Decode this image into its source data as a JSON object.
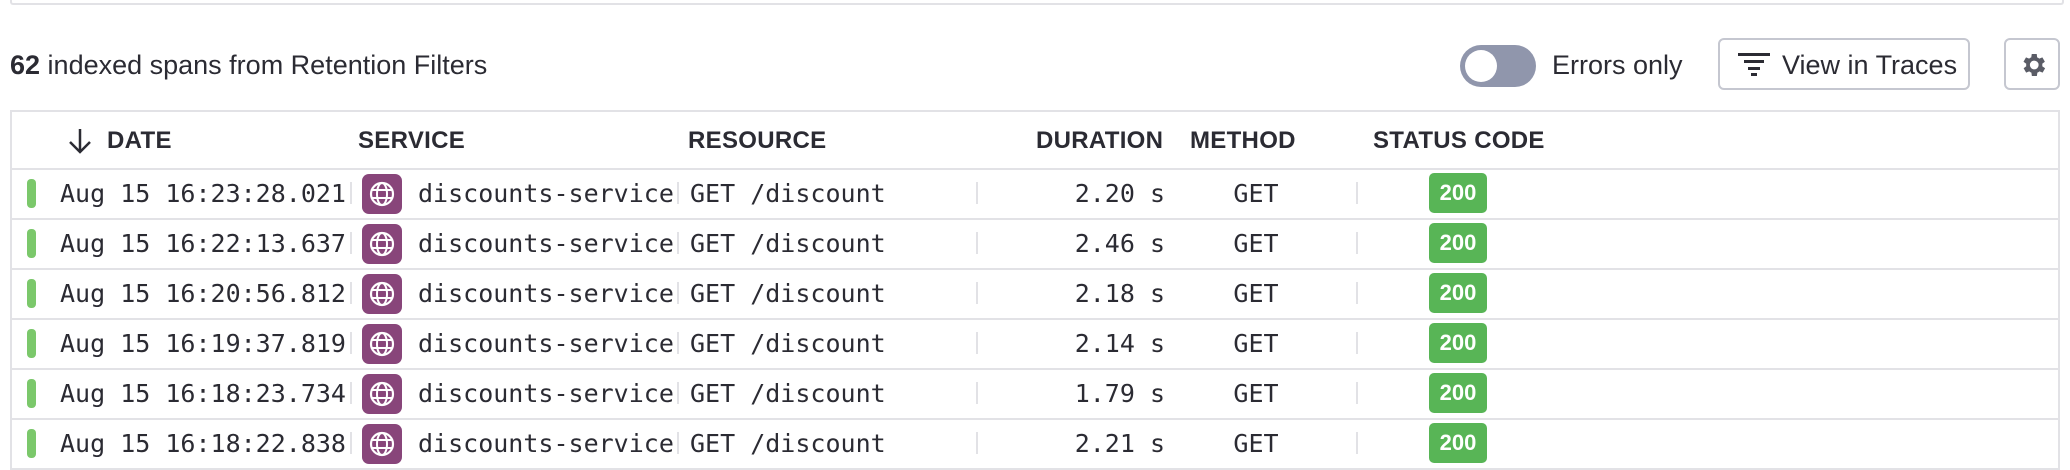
{
  "summary": {
    "count": "62",
    "text": " indexed spans from Retention Filters"
  },
  "toggle": {
    "label": "Errors only",
    "on": false
  },
  "toolbar": {
    "view_traces_label": "View in Traces"
  },
  "table": {
    "columns": {
      "date": "DATE",
      "service": "SERVICE",
      "resource": "RESOURCE",
      "duration": "DURATION",
      "method": "METHOD",
      "status_code": "STATUS CODE"
    },
    "sort": {
      "column": "date",
      "direction": "descending"
    },
    "rows": [
      {
        "date": "Aug 15 16:23:28.021",
        "service": "discounts-service",
        "resource": "GET /discount",
        "duration": "2.20 s",
        "method": "GET",
        "status_code": "200"
      },
      {
        "date": "Aug 15 16:22:13.637",
        "service": "discounts-service",
        "resource": "GET /discount",
        "duration": "2.46 s",
        "method": "GET",
        "status_code": "200"
      },
      {
        "date": "Aug 15 16:20:56.812",
        "service": "discounts-service",
        "resource": "GET /discount",
        "duration": "2.18 s",
        "method": "GET",
        "status_code": "200"
      },
      {
        "date": "Aug 15 16:19:37.819",
        "service": "discounts-service",
        "resource": "GET /discount",
        "duration": "2.14 s",
        "method": "GET",
        "status_code": "200"
      },
      {
        "date": "Aug 15 16:18:23.734",
        "service": "discounts-service",
        "resource": "GET /discount",
        "duration": "1.79 s",
        "method": "GET",
        "status_code": "200"
      },
      {
        "date": "Aug 15 16:18:22.838",
        "service": "discounts-service",
        "resource": "GET /discount",
        "duration": "2.21 s",
        "method": "GET",
        "status_code": "200"
      }
    ]
  },
  "colors": {
    "status_ok": "#58b556",
    "status_bar": "#7bc86b",
    "service_icon_bg": "#88457a",
    "toggle_off": "#9096ac",
    "border": "#e2e2e6"
  },
  "icons": {
    "sort": "arrow-down-icon",
    "filter": "filter-lines-icon",
    "settings": "gear-icon",
    "service": "globe-icon"
  }
}
